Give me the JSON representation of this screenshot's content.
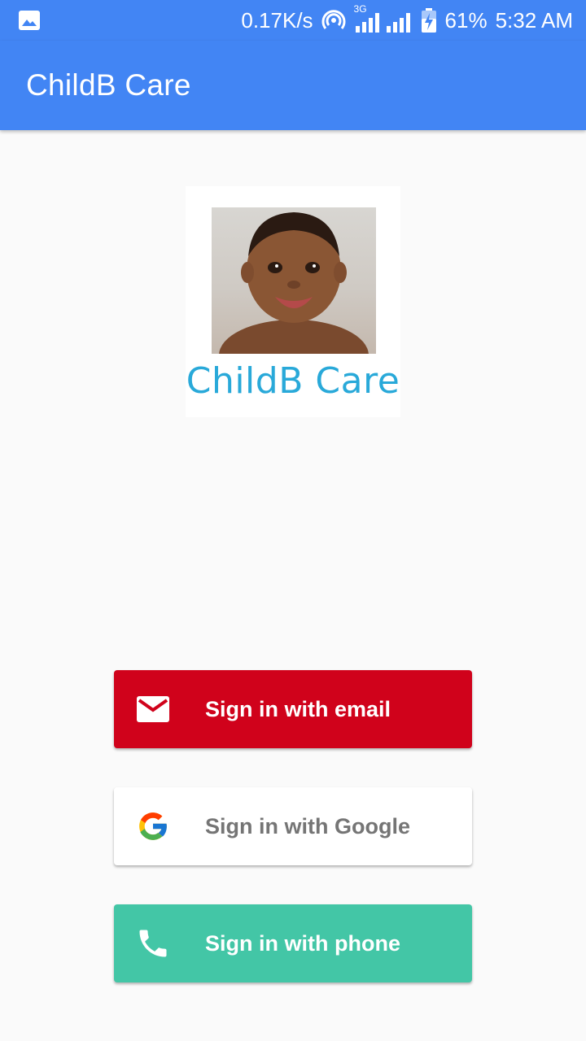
{
  "status_bar": {
    "network_speed": "0.17K/s",
    "network_type": "3G",
    "battery": "61%",
    "time": "5:32 AM",
    "icons": [
      "image-icon",
      "hotspot-icon",
      "signal-icon",
      "battery-charging-icon"
    ]
  },
  "app_bar": {
    "title": "ChildB Care",
    "color": "#4285f4"
  },
  "logo": {
    "text": "ChildB Care",
    "text_color": "#29a9d9"
  },
  "auth_buttons": [
    {
      "label": "Sign in with email",
      "icon": "email-icon",
      "color": "#d0021b"
    },
    {
      "label": "Sign in with Google",
      "icon": "google-icon",
      "color": "#ffffff"
    },
    {
      "label": "Sign in with phone",
      "icon": "phone-icon",
      "color": "#43c6a6"
    }
  ]
}
